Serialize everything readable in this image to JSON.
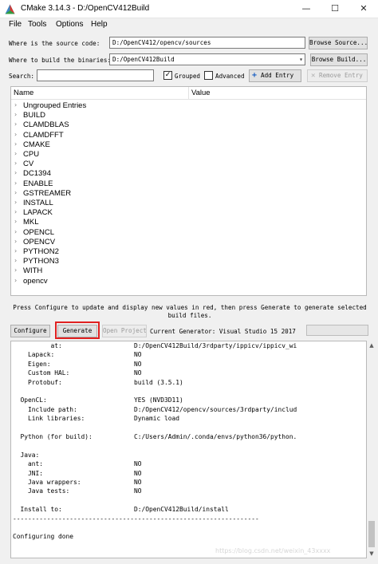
{
  "window": {
    "title": "CMake 3.14.3 - D:/OpenCV412Build",
    "minimize": "—",
    "maximize": "☐",
    "close": "✕"
  },
  "menu": [
    "File",
    "Tools",
    "Options",
    "Help"
  ],
  "source": {
    "label": "Where is the source code:",
    "value": "D:/OpenCV412/opencv/sources",
    "button": "Browse Source..."
  },
  "build": {
    "label": "Where to build the binaries:",
    "value": "D:/OpenCV412Build",
    "button": "Browse Build..."
  },
  "search": {
    "label": "Search:",
    "value": ""
  },
  "options": {
    "grouped_label": "Grouped",
    "grouped_checked": true,
    "advanced_label": "Advanced",
    "advanced_checked": false,
    "add_entry": "Add Entry",
    "remove_entry": "Remove Entry"
  },
  "tree": {
    "col_name": "Name",
    "col_value": "Value",
    "items": [
      "Ungrouped Entries",
      "BUILD",
      "CLAMDBLAS",
      "CLAMDFFT",
      "CMAKE",
      "CPU",
      "CV",
      "DC1394",
      "ENABLE",
      "GSTREAMER",
      "INSTALL",
      "LAPACK",
      "MKL",
      "OPENCL",
      "OPENCV",
      "PYTHON2",
      "PYTHON3",
      "WITH",
      "opencv"
    ]
  },
  "hint": "Press Configure to update and display new values in red, then press Generate to generate selected build files.",
  "actions": {
    "configure": "Configure",
    "generate": "Generate",
    "open_project": "Open Project",
    "generator": "Current Generator: Visual Studio 15 2017"
  },
  "output": [
    "          at:                   D:/OpenCV412Build/3rdparty/ippicv/ippicv_wi",
    "    Lapack:                     NO",
    "    Eigen:                      NO",
    "    Custom HAL:                 NO",
    "    Protobuf:                   build (3.5.1)",
    "",
    "  OpenCL:                       YES (NVD3D11)",
    "    Include path:               D:/OpenCV412/opencv/sources/3rdparty/includ",
    "    Link libraries:             Dynamic load",
    "",
    "  Python (for build):           C:/Users/Admin/.conda/envs/python36/python.",
    "",
    "  Java:",
    "    ant:                        NO",
    "    JNI:                        NO",
    "    Java wrappers:              NO",
    "    Java tests:                 NO",
    "",
    "  Install to:                   D:/OpenCV412Build/install",
    "-----------------------------------------------------------------",
    "",
    "Configuring done"
  ],
  "watermark": "https://blog.csdn.net/weixin_43xxxx",
  "icons": {
    "app": "cmake-triangle-icon",
    "add": "plus-icon",
    "remove": "x-icon",
    "expand": "chevron-right-icon"
  },
  "colors": {
    "highlight_box": "#e02020"
  }
}
